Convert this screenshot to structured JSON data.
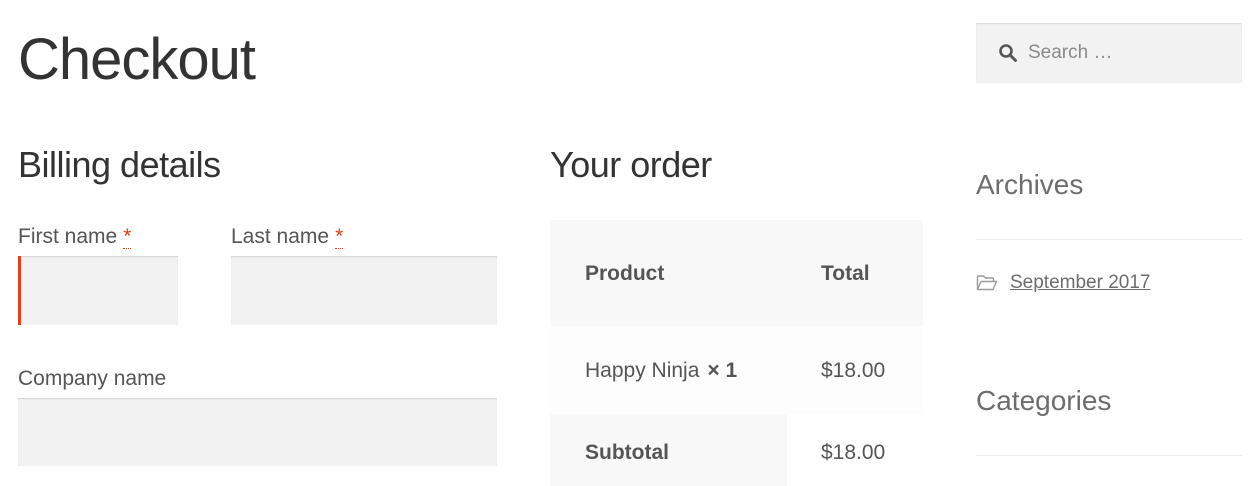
{
  "page": {
    "title": "Checkout"
  },
  "billing": {
    "title": "Billing details",
    "required_mark": "*",
    "first_name": {
      "label": "First name",
      "value": ""
    },
    "last_name": {
      "label": "Last name",
      "value": ""
    },
    "company": {
      "label": "Company name",
      "value": ""
    }
  },
  "order": {
    "title": "Your order",
    "headers": {
      "product": "Product",
      "total": "Total"
    },
    "items": [
      {
        "name": "Happy Ninja",
        "qty": "× 1",
        "total": "$18.00"
      }
    ],
    "subtotal": {
      "label": "Subtotal",
      "value": "$18.00"
    }
  },
  "sidebar": {
    "search": {
      "placeholder": "Search …",
      "icon": "search-icon"
    },
    "archives": {
      "title": "Archives",
      "items": [
        {
          "label": "September 2017",
          "icon": "folder-open-icon"
        }
      ]
    },
    "categories": {
      "title": "Categories"
    }
  },
  "colors": {
    "required": "#e2401c",
    "field_bg": "#f2f2f2",
    "table_bg": "#f8f8f8",
    "text": "#555555"
  }
}
